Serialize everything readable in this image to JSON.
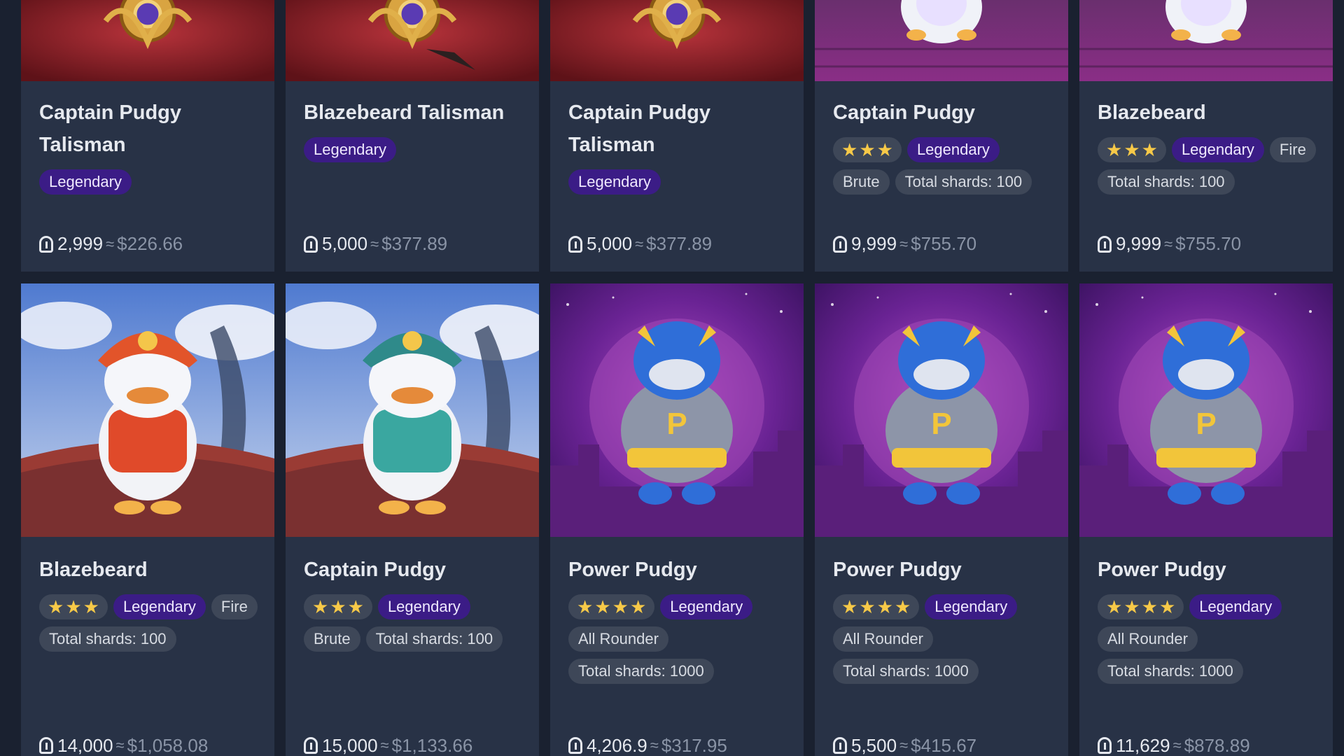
{
  "currency": {
    "approx_symbol": "≈",
    "coin_icon": "pudgy-coin-icon"
  },
  "rows": [
    {
      "cards": [
        {
          "title": "Captain Pudgy Talisman",
          "stars": 0,
          "rarity": "Legendary",
          "tags": [],
          "price": "2,999",
          "usd": "$226.66",
          "art": "talisman-gold"
        },
        {
          "title": "Blazebeard Talisman",
          "stars": 0,
          "rarity": "Legendary",
          "tags": [],
          "price": "5,000",
          "usd": "$377.89",
          "art": "talisman-blaze"
        },
        {
          "title": "Captain Pudgy Talisman",
          "stars": 0,
          "rarity": "Legendary",
          "tags": [],
          "price": "5,000",
          "usd": "$377.89",
          "art": "talisman-gold"
        },
        {
          "title": "Captain Pudgy",
          "stars": 3,
          "rarity": "Legendary",
          "tags": [
            "Brute",
            "Total shards: 100"
          ],
          "price": "9,999",
          "usd": "$755.70",
          "art": "penguin-deck"
        },
        {
          "title": "Blazebeard",
          "stars": 3,
          "rarity": "Legendary",
          "tags": [
            "Fire",
            "Total shards: 100"
          ],
          "price": "9,999",
          "usd": "$755.70",
          "art": "penguin-deck"
        }
      ]
    },
    {
      "cards": [
        {
          "title": "Blazebeard",
          "stars": 3,
          "rarity": "Legendary",
          "tags": [
            "Fire",
            "Total shards: 100"
          ],
          "price": "14,000",
          "usd": "$1,058.08",
          "art": "pirate-red"
        },
        {
          "title": "Captain Pudgy",
          "stars": 3,
          "rarity": "Legendary",
          "tags": [
            "Brute",
            "Total shards: 100"
          ],
          "price": "15,000",
          "usd": "$1,133.66",
          "art": "pirate-teal"
        },
        {
          "title": "Power Pudgy",
          "stars": 4,
          "rarity": "Legendary",
          "tags": [
            "All Rounder",
            "Total shards: 1000"
          ],
          "price": "4,206.9",
          "usd": "$317.95",
          "art": "power-pudgy"
        },
        {
          "title": "Power Pudgy",
          "stars": 4,
          "rarity": "Legendary",
          "tags": [
            "All Rounder",
            "Total shards: 1000"
          ],
          "price": "5,500",
          "usd": "$415.67",
          "art": "power-pudgy"
        },
        {
          "title": "Power Pudgy",
          "stars": 4,
          "rarity": "Legendary",
          "tags": [
            "All Rounder",
            "Total shards: 1000"
          ],
          "price": "11,629",
          "usd": "$878.89",
          "art": "power-pudgy"
        }
      ]
    }
  ],
  "colors": {
    "page_bg": "#1a2130",
    "card_bg": "#283246",
    "legendary_badge": "#3b1c86",
    "tag_badge": "#3e4758",
    "star": "#f7c948",
    "usd_text": "#8a94a6"
  }
}
